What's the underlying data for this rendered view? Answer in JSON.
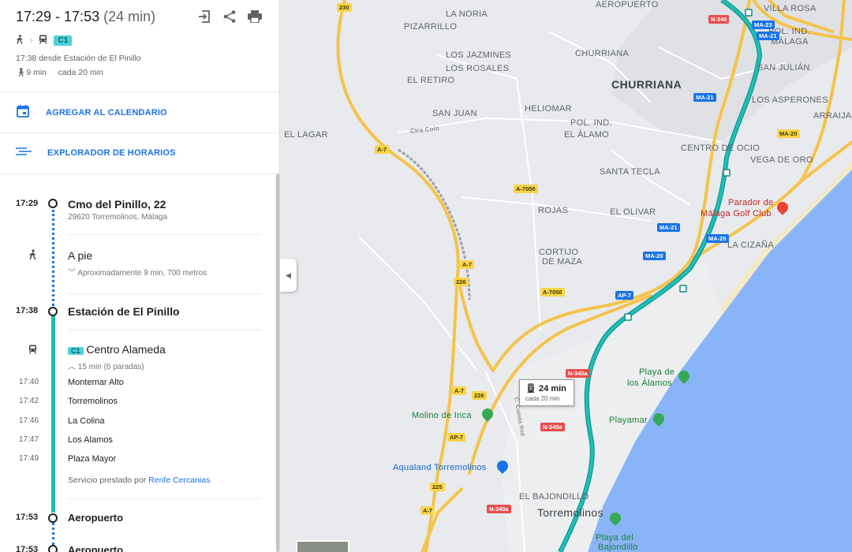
{
  "header": {
    "time_range": "17:29 - 17:53",
    "duration": "(24 min)",
    "route_badge": "C1",
    "departure": "17:38 desde Estación de El Pinillo",
    "walk_time": "9 min",
    "frequency": "cada 20 min"
  },
  "actions": {
    "calendar": "AGREGAR AL CALENDARIO",
    "schedule": "EXPLORADOR DE HORARIOS"
  },
  "timeline": {
    "start": {
      "time": "17:29",
      "title": "Cmo del Pinillo, 22",
      "subtitle": "29620 Torremolinos, Málaga"
    },
    "walk": {
      "label": "A pie",
      "detail": "Aproximadamente 9 min, 700 metros"
    },
    "station": {
      "time": "17:38",
      "title": "Estación de El Pinillo"
    },
    "train": {
      "badge": "C1",
      "label": "Centro Alameda",
      "detail": "15 min (6 paradas)"
    },
    "stops": [
      {
        "time": "17:40",
        "name": "Montemar Alto"
      },
      {
        "time": "17:42",
        "name": "Torremolinos"
      },
      {
        "time": "17:46",
        "name": "La Colina"
      },
      {
        "time": "17:47",
        "name": "Los Alamos"
      },
      {
        "time": "17:49",
        "name": "Plaza Mayor"
      }
    ],
    "service_prefix": "Servicio prestado por",
    "service_link": "Renfe Cercanias",
    "arrival": {
      "time": "17:53",
      "title": "Aeropuerto"
    },
    "final": {
      "time": "17:53",
      "title": "Aeropuerto"
    }
  },
  "map": {
    "popup": {
      "duration": "24 min",
      "frequency": "cada 20 min"
    },
    "areas": [
      "LA NORIA",
      "PIZARRILLO",
      "LOS JAZMINES",
      "LOS ROSALES",
      "EL RETIRO",
      "CHURRIANA",
      "HELIOMAR",
      "SAN JUAN",
      "EL LAGAR",
      "POL. IND.",
      "EL ÁLAMO",
      "SANTA TECLA",
      "ROJAS",
      "EL OLIVAR",
      "CORTIJO",
      "DE MAZA",
      "AEROPUERTO",
      "VILLA ROSA",
      "POL. IND.",
      "MÁLAGA",
      "SAN JULIÁN",
      "LOS ASPERONES",
      "ARRAIJA",
      "CENTRO DE OCIO",
      "VEGA DE ORO",
      "LA CIZAÑA",
      "EL BAJONDILLO"
    ],
    "big_areas": [
      "CHURRIANA"
    ],
    "town": "Torremolinos",
    "road_label": "Ctra Coín",
    "road_label2": "C. Cuesta Rod",
    "pois": {
      "parador_1": "Parador de",
      "parador_2": "Málaga Golf Club",
      "playa_alamos_1": "Playa de",
      "playa_alamos_2": "los Álamos",
      "playamar": "Playamar",
      "molino": "Molino de Inca",
      "aqualand": "Aqualand Torremolinos",
      "playa_bajondillo_1": "Playa del",
      "playa_bajondillo_2": "Bajondillo"
    },
    "shields_yellow": [
      "230",
      "A-7",
      "A-7050",
      "A-7",
      "226",
      "A-7050",
      "A-7",
      "226",
      "AP-7",
      "225",
      "A-7",
      "MA-20"
    ],
    "shields_blue": [
      "MA-21",
      "MA-21",
      "MA-20",
      "AP-7",
      "MA-20",
      "MA-23",
      "MA-21"
    ],
    "shields_red": [
      "N-340a",
      "N-340a",
      "N-340a",
      "N-340"
    ],
    "colors": {
      "transit": "#1bbfb7",
      "highway": "#f5c34a",
      "water": "#8ab4f8",
      "land": "#e8eaed"
    }
  }
}
